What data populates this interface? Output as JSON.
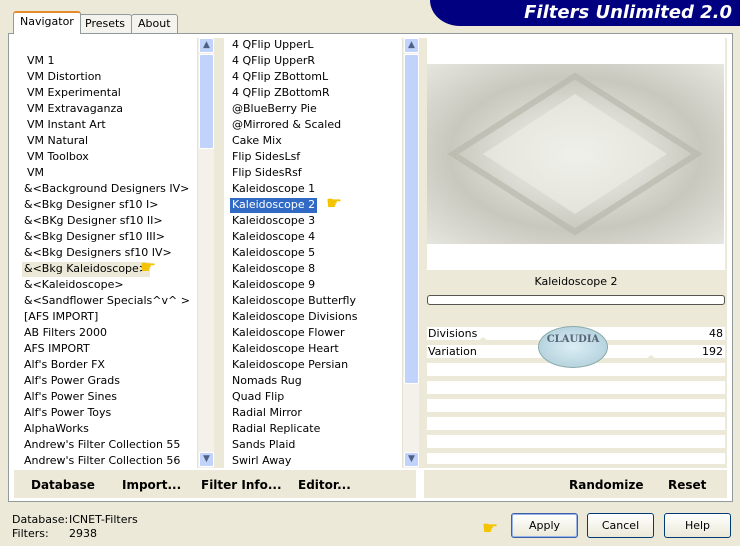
{
  "app_title": "Filters Unlimited 2.0",
  "tabs": [
    {
      "label": "Navigator",
      "active": true
    },
    {
      "label": "Presets"
    },
    {
      "label": "About"
    }
  ],
  "categories": {
    "items": [
      "VM 1",
      "VM Distortion",
      "VM Experimental",
      "VM Extravaganza",
      "VM Instant Art",
      "VM Natural",
      "VM Toolbox",
      "VM",
      "&<Background Designers IV>",
      "&<Bkg Designer sf10 I>",
      "&<BKg Designer sf10 II>",
      "&<Bkg Designer sf10 III>",
      "&<Bkg Designers sf10 IV>",
      "&<Bkg Kaleidoscope>",
      "&<Kaleidoscope>",
      "&<Sandflower Specials^v^ >",
      "[AFS IMPORT]",
      "AB Filters 2000",
      "AFS IMPORT",
      "Alf's Border FX",
      "Alf's Power Grads",
      "Alf's Power Sines",
      "Alf's Power Toys",
      "AlphaWorks",
      "Andrew's Filter Collection 55",
      "Andrew's Filter Collection 56"
    ],
    "highlighted": "&<Bkg Kaleidoscope>"
  },
  "filters": {
    "items": [
      "4 QFlip UpperL",
      "4 QFlip UpperR",
      "4 QFlip ZBottomL",
      "4 QFlip ZBottomR",
      "@BlueBerry Pie",
      "@Mirrored & Scaled",
      "Cake Mix",
      "Flip SidesLsf",
      "Flip SidesRsf",
      "Kaleidoscope 1",
      "Kaleidoscope 2",
      "Kaleidoscope 3",
      "Kaleidoscope 4",
      "Kaleidoscope 5",
      "Kaleidoscope 8",
      "Kaleidoscope 9",
      "Kaleidoscope Butterfly",
      "Kaleidoscope Divisions",
      "Kaleidoscope Flower",
      "Kaleidoscope Heart",
      "Kaleidoscope Persian",
      "Nomads Rug",
      "Quad Flip",
      "Radial Mirror",
      "Radial Replicate",
      "Sands Plaid",
      "Swirl Away"
    ],
    "selected": "Kaleidoscope 2"
  },
  "preview": {
    "filter_name": "Kaleidoscope 2",
    "params": [
      {
        "label": "Divisions",
        "value": "48",
        "level": 0.19
      },
      {
        "label": "Variation",
        "value": "192",
        "level": 0.75
      }
    ],
    "watermark": "CLAUDIA"
  },
  "bottom_buttons": {
    "database": "Database",
    "import": "Import...",
    "filter_info": "Filter Info...",
    "editor": "Editor...",
    "randomize": "Randomize",
    "reset": "Reset"
  },
  "status": {
    "database_label": "Database:",
    "database_value": "ICNET-Filters",
    "filters_label": "Filters:",
    "filters_value": "2938"
  },
  "dialog_buttons": {
    "apply": "Apply",
    "cancel": "Cancel",
    "help": "Help"
  },
  "colors": {
    "banner": "#000080",
    "selection": "#316ac5",
    "tab_accent": "#e68b2c"
  }
}
